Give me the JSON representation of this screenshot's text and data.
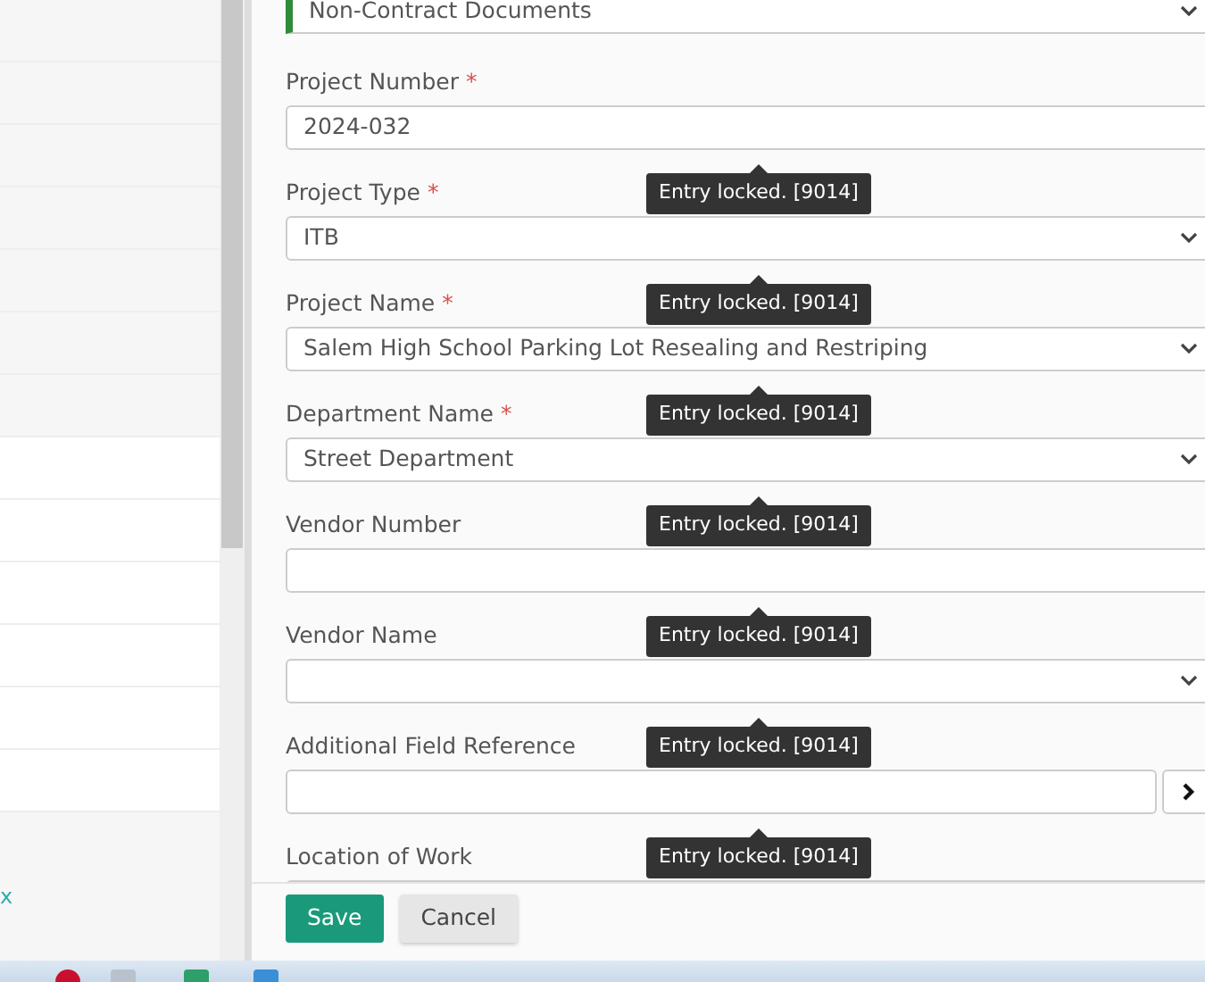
{
  "left_panel": {
    "link": "x"
  },
  "document_type": {
    "value": "Non-Contract Documents"
  },
  "fields": [
    {
      "label": "Project Number",
      "required_mark": "*",
      "kind": "text",
      "value": "2024-032"
    },
    {
      "label": "Project Type",
      "required_mark": "*",
      "kind": "select",
      "value": "ITB",
      "tooltip": "Entry locked. [9014]"
    },
    {
      "label": "Project Name",
      "required_mark": "*",
      "kind": "select",
      "value": "Salem High School Parking Lot Resealing and Restriping",
      "tooltip": "Entry locked. [9014]"
    },
    {
      "label": "Department Name",
      "required_mark": "*",
      "kind": "select",
      "value": "Street Department",
      "tooltip": "Entry locked. [9014]"
    },
    {
      "label": "Vendor Number",
      "kind": "text",
      "tooltip": "Entry locked. [9014]"
    },
    {
      "label": "Vendor Name",
      "kind": "select",
      "tooltip": "Entry locked. [9014]"
    },
    {
      "label": "Additional Field Reference",
      "kind": "lookup",
      "tooltip": "Entry locked. [9014]"
    },
    {
      "label": "Location of Work",
      "kind": "text",
      "tooltip": "Entry locked. [9014]"
    }
  ],
  "buttons": [
    {
      "label": "Save",
      "kind": "primary"
    },
    {
      "label": "Cancel",
      "kind": "secondary"
    }
  ]
}
